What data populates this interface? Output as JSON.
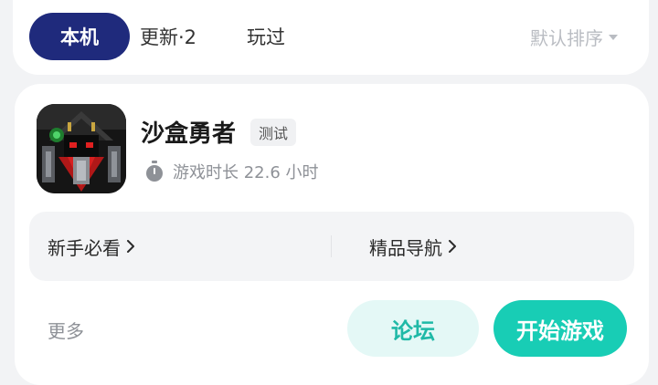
{
  "tabs": {
    "local": "本机",
    "updates": "更新·2",
    "played": "玩过",
    "sort": "默认排序"
  },
  "game": {
    "title": "沙盒勇者",
    "badge": "测试",
    "playtime": "游戏时长 22.6 小时",
    "icon": "game-knight-icon"
  },
  "quicklinks": {
    "beginner": "新手必看",
    "featured": "精品导航"
  },
  "actions": {
    "more": "更多",
    "forum": "论坛",
    "play": "开始游戏"
  },
  "colors": {
    "active_tab": "#1f2a7c",
    "play_button": "#18cdb5",
    "forum_button_bg": "#e4f8f6",
    "forum_button_text": "#1fb9a7"
  }
}
